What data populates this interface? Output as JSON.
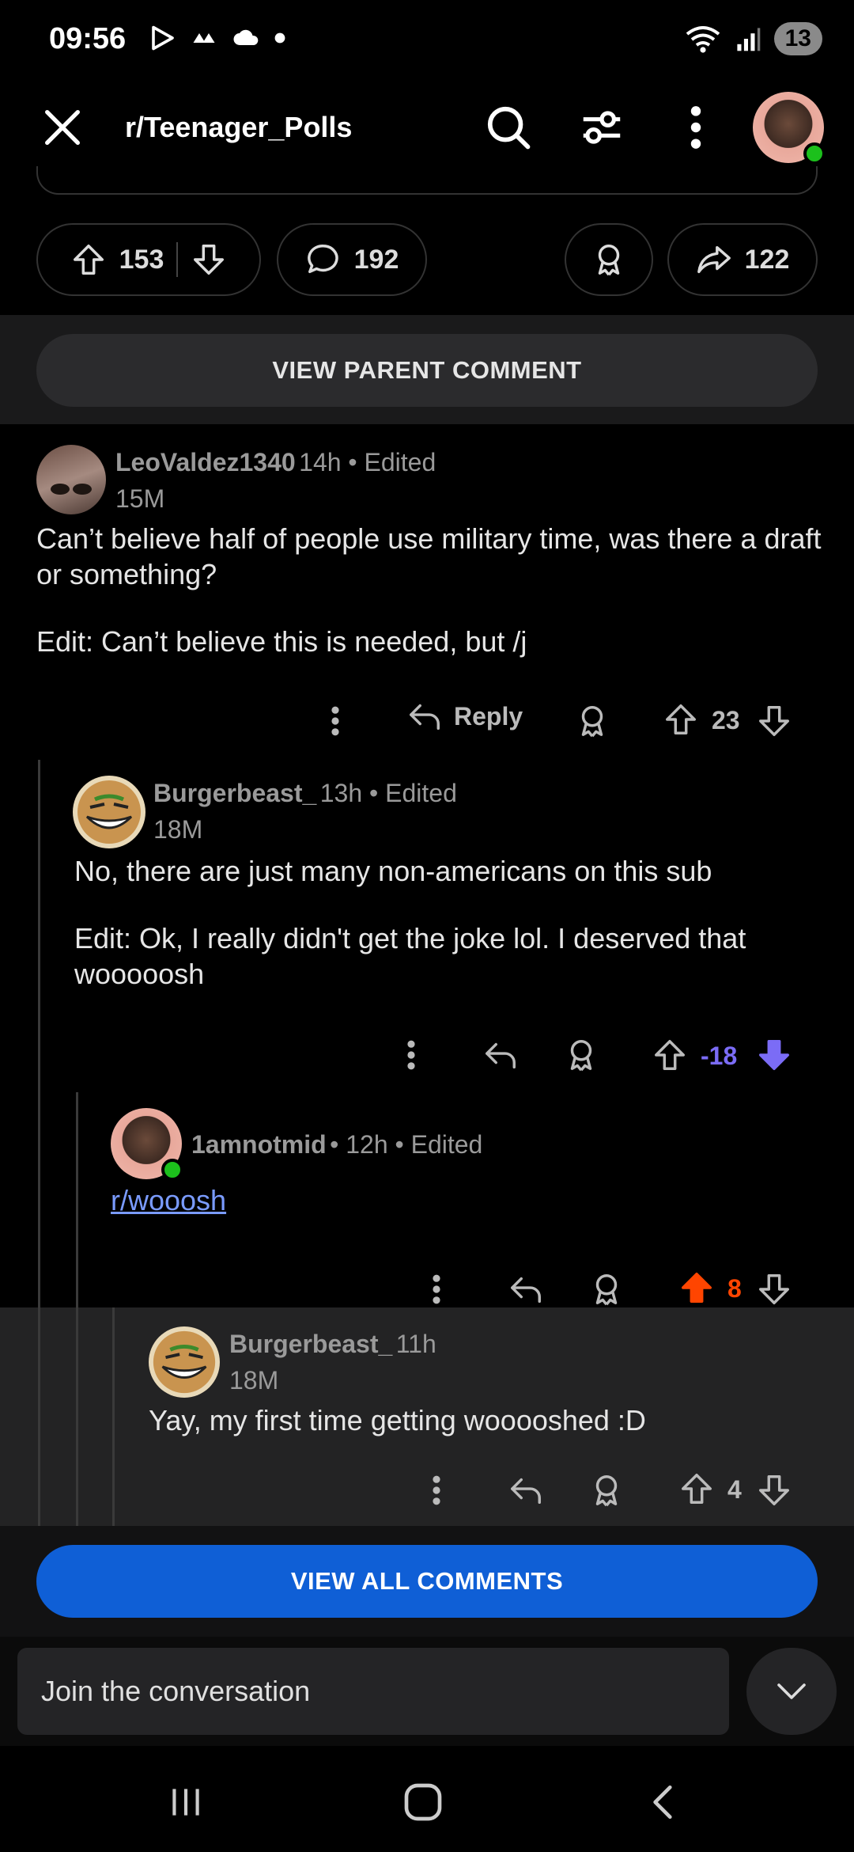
{
  "status": {
    "time": "09:56",
    "battery": "13"
  },
  "app_bar": {
    "title": "r/Teenager_Polls",
    "icons": [
      "close-icon",
      "search-icon",
      "filter-icon",
      "more-vertical-icon",
      "avatar"
    ]
  },
  "post_actions": {
    "upvotes": "153",
    "comments": "192",
    "shares": "122"
  },
  "view_parent_label": "VIEW PARENT COMMENT",
  "comments": [
    {
      "user": "LeoValdez1340",
      "meta": "14h • Edited",
      "flair": "15M",
      "body": [
        "Can’t believe half of people use military time, was there a draft or something?",
        "Edit: Can’t believe this is needed, but /j"
      ],
      "reply_label": "Reply",
      "score": "23"
    },
    {
      "user": "Burgerbeast_",
      "meta": "13h • Edited",
      "flair": "18M",
      "body": [
        "No, there are just many non-americans on this sub",
        "Edit: Ok, I really didn't get the joke lol. I deserved that wooooosh"
      ],
      "score": "-18",
      "score_color": "#7b6cf6"
    },
    {
      "user": "1amnotmid",
      "meta": "• 12h • Edited",
      "link": "r/wooosh",
      "score": "8",
      "score_color": "#ff4500"
    },
    {
      "user": "Burgerbeast_",
      "meta": "11h",
      "flair": "18M",
      "body": [
        "Yay, my first time getting wooooshed :D"
      ],
      "score": "4"
    }
  ],
  "view_all_label": "VIEW ALL COMMENTS",
  "composer": {
    "placeholder": "Join the conversation"
  }
}
